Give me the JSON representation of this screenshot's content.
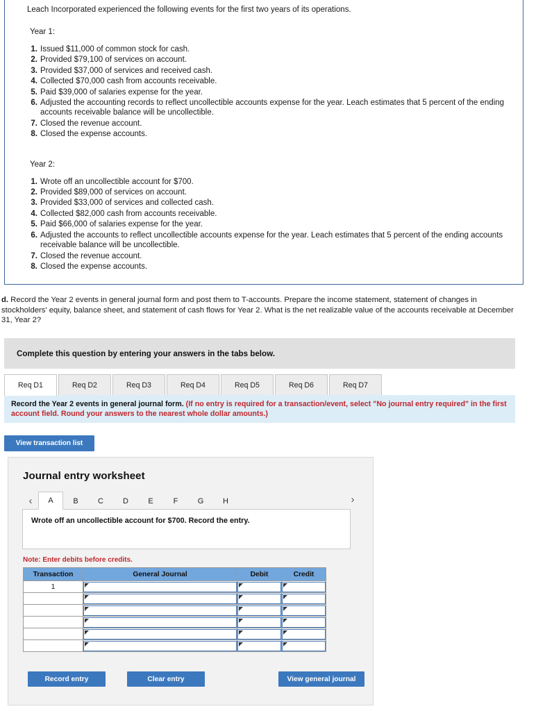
{
  "scenario": {
    "intro": "Leach Incorporated experienced the following events for the first two years of its operations.",
    "year1_label": "Year 1:",
    "year1_events": [
      "Issued $11,000 of common stock for cash.",
      "Provided $79,100 of services on account.",
      "Provided $37,000 of services and received cash.",
      "Collected $70,000 cash from accounts receivable.",
      "Paid $39,000 of salaries expense for the year.",
      "Adjusted the accounting records to reflect uncollectible accounts expense for the year. Leach estimates that 5 percent of the ending accounts receivable balance will be uncollectible.",
      "Closed the revenue account.",
      "Closed the expense accounts."
    ],
    "year2_label": "Year 2:",
    "year2_events": [
      "Wrote off an uncollectible account for $700.",
      "Provided $89,000 of services on account.",
      "Provided $33,000 of services and collected cash.",
      "Collected $82,000 cash from accounts receivable.",
      "Paid $66,000 of salaries expense for the year.",
      "Adjusted the accounts to reflect uncollectible accounts expense for the year. Leach estimates that 5 percent of the ending accounts receivable balance will be uncollectible.",
      "Closed the revenue account.",
      "Closed the expense accounts."
    ]
  },
  "requirement": {
    "letter": "d.",
    "text": " Record the Year 2 events in general journal form and post them to T-accounts. Prepare the income statement, statement of changes in stockholders' equity, balance sheet, and statement of cash flows for Year 2. What is the net realizable value of the accounts receivable at December 31, Year 2?"
  },
  "complete_banner": "Complete this question by entering your answers in the tabs below.",
  "req_tabs": [
    {
      "label": "Req D1",
      "active": true
    },
    {
      "label": "Req D2",
      "active": false
    },
    {
      "label": "Req D3",
      "active": false
    },
    {
      "label": "Req D4",
      "active": false
    },
    {
      "label": "Req D5",
      "active": false
    },
    {
      "label": "Req D6",
      "active": false
    },
    {
      "label": "Req D7",
      "active": false
    }
  ],
  "instruction": {
    "black": "Record the Year 2 events in general journal form. ",
    "red": "(If no entry is required for a transaction/event, select \"No journal entry required\" in the first account field. Round your answers to the nearest whole dollar amounts.)"
  },
  "view_transaction_list_label": "View transaction list",
  "worksheet": {
    "title": "Journal entry worksheet",
    "prev_arrow": "‹",
    "next_arrow": "›",
    "letter_tabs": [
      {
        "label": "A",
        "active": true
      },
      {
        "label": "B",
        "active": false
      },
      {
        "label": "C",
        "active": false
      },
      {
        "label": "D",
        "active": false
      },
      {
        "label": "E",
        "active": false
      },
      {
        "label": "F",
        "active": false
      },
      {
        "label": "G",
        "active": false
      },
      {
        "label": "H",
        "active": false
      }
    ],
    "transaction_description": "Wrote off an uncollectible account for $700. Record the entry.",
    "note": "Note: Enter debits before credits.",
    "table": {
      "headers": [
        "Transaction",
        "General Journal",
        "Debit",
        "Credit"
      ],
      "rows": [
        {
          "transaction": "1",
          "general_journal": "",
          "debit": "",
          "credit": ""
        },
        {
          "transaction": "",
          "general_journal": "",
          "debit": "",
          "credit": ""
        },
        {
          "transaction": "",
          "general_journal": "",
          "debit": "",
          "credit": ""
        },
        {
          "transaction": "",
          "general_journal": "",
          "debit": "",
          "credit": ""
        },
        {
          "transaction": "",
          "general_journal": "",
          "debit": "",
          "credit": ""
        },
        {
          "transaction": "",
          "general_journal": "",
          "debit": "",
          "credit": ""
        }
      ]
    },
    "buttons": {
      "record_entry": "Record entry",
      "clear_entry": "Clear entry",
      "view_general_journal": "View general journal"
    }
  },
  "colors": {
    "primary_button": "#3c78bd",
    "table_header": "#72a7de",
    "instruction_bg": "#dcedf8",
    "banner_bg": "#e0e0e0",
    "panel_bg": "#f2f2f2",
    "alert_red": "#c1272d",
    "box_border": "#3e6698"
  }
}
